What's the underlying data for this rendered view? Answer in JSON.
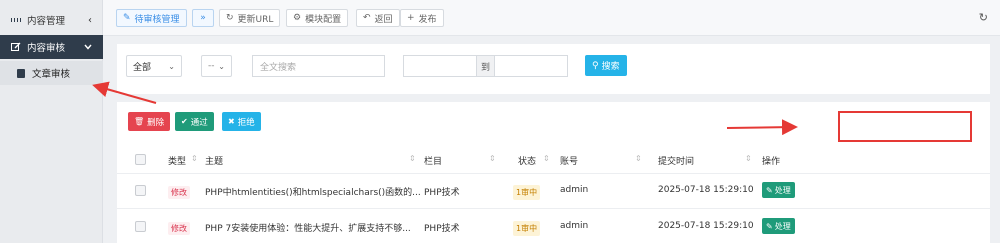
{
  "sidebar": {
    "items": [
      {
        "label": "内容管理",
        "arrow": "‹"
      },
      {
        "label": "内容审核",
        "arrow": "⌄"
      },
      {
        "label": "文章审核"
      }
    ]
  },
  "toolbar": {
    "pending_label": "待审核管理",
    "update_url_label": "更新URL",
    "module_config_label": "模块配置",
    "back_label": "返回",
    "publish_label": "发布"
  },
  "search": {
    "select_all": "全部",
    "select_dash": "--",
    "fulltext_placeholder": "全文搜索",
    "range_to": "到",
    "search_button": "搜索"
  },
  "actions": {
    "delete": "删除",
    "pass": "通过",
    "reject": "拒绝"
  },
  "table": {
    "headers": {
      "type": "类型",
      "title": "主题",
      "column": "栏目",
      "status": "状态",
      "account": "账号",
      "submit_time": "提交时间",
      "operation": "操作"
    },
    "rows": [
      {
        "type": "修改",
        "title": "PHP中htmlentities()和htmlspecialchars()函数的...",
        "column": "PHP技术",
        "status": "1审中",
        "account": "admin",
        "time": "2025-07-18 15:29:10",
        "op": "处理"
      },
      {
        "type": "修改",
        "title": "PHP 7安装使用体验：性能大提升、扩展支持不够...",
        "column": "PHP技术",
        "status": "1审中",
        "account": "admin",
        "time": "2025-07-18 15:29:10",
        "op": "处理"
      }
    ]
  },
  "colors": {
    "sidebar_active": "#2f3c4b",
    "delete": "#e5444f",
    "pass": "#1f9b7a",
    "reject": "#25b3e8",
    "annotation": "#e53935"
  }
}
